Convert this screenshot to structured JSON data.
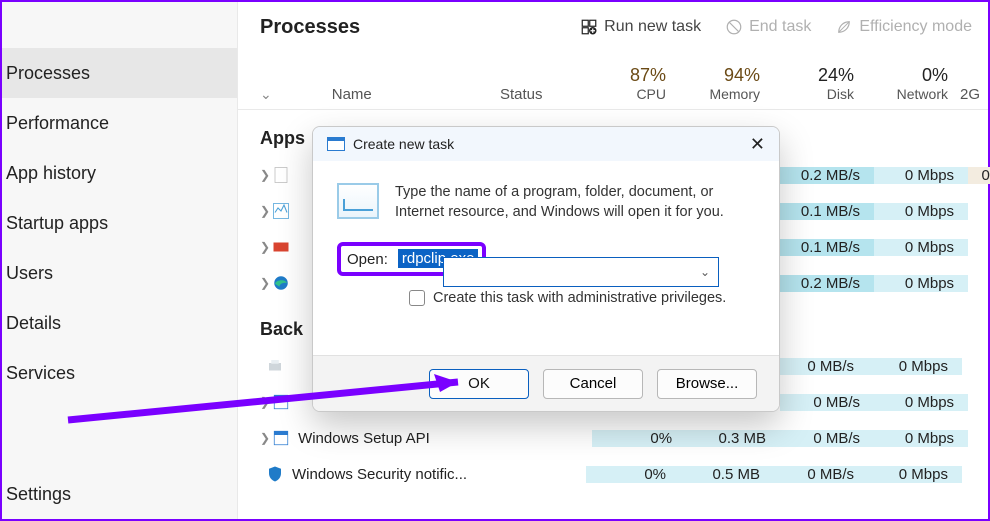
{
  "sidebar": {
    "items": [
      {
        "label": "Processes"
      },
      {
        "label": "Performance"
      },
      {
        "label": "App history"
      },
      {
        "label": "Startup apps"
      },
      {
        "label": "Users"
      },
      {
        "label": "Details"
      },
      {
        "label": "Services"
      },
      {
        "label": "Settings"
      }
    ]
  },
  "header": {
    "title": "Processes",
    "actions": {
      "run_new_task": "Run new task",
      "end_task": "End task",
      "efficiency_mode": "Efficiency mode"
    }
  },
  "columns": {
    "name": "Name",
    "status": "Status",
    "cpu_pct": "87%",
    "cpu_lbl": "CPU",
    "mem_pct": "94%",
    "mem_lbl": "Memory",
    "disk_pct": "24%",
    "disk_lbl": "Disk",
    "net_pct": "0%",
    "net_lbl": "Network",
    "gpu_partial": "2"
  },
  "sections": {
    "apps": "Apps",
    "background": "Back"
  },
  "rows": [
    {
      "name": "",
      "cpu": "",
      "mem": "",
      "disk": "0.2 MB/s",
      "net": "0 Mbps",
      "gpu": "0."
    },
    {
      "name": "",
      "cpu": "",
      "mem": "",
      "disk": "0.1 MB/s",
      "net": "0 Mbps",
      "gpu": ""
    },
    {
      "name": "",
      "cpu": "",
      "mem": "",
      "disk": "0.1 MB/s",
      "net": "0 Mbps",
      "gpu": ""
    },
    {
      "name": "",
      "cpu": "",
      "mem": "",
      "disk": "0.2 MB/s",
      "net": "0 Mbps",
      "gpu": ""
    }
  ],
  "bg_rows": [
    {
      "name": "",
      "cpu": "",
      "mem": "",
      "disk": "0 MB/s",
      "net": "0 Mbps",
      "gpu": ""
    },
    {
      "name": "",
      "cpu": "",
      "mem": "",
      "disk": "0 MB/s",
      "net": "0 Mbps",
      "gpu": ""
    },
    {
      "name": "Windows Setup API",
      "cpu": "0%",
      "mem": "0.3 MB",
      "disk": "0 MB/s",
      "net": "0 Mbps",
      "gpu": ""
    },
    {
      "name": "Windows Security notific...",
      "cpu": "0%",
      "mem": "0.5 MB",
      "disk": "0 MB/s",
      "net": "0 Mbps",
      "gpu": ""
    }
  ],
  "dialog": {
    "title": "Create new task",
    "description": "Type the name of a program, folder, document, or Internet resource, and Windows will open it for you.",
    "open_label": "Open:",
    "open_value": "rdpclip.exe",
    "admin_checkbox": "Create this task with administrative privileges.",
    "buttons": {
      "ok": "OK",
      "cancel": "Cancel",
      "browse": "Browse..."
    }
  },
  "annotation": {
    "highlight_color": "#7a00ff"
  }
}
